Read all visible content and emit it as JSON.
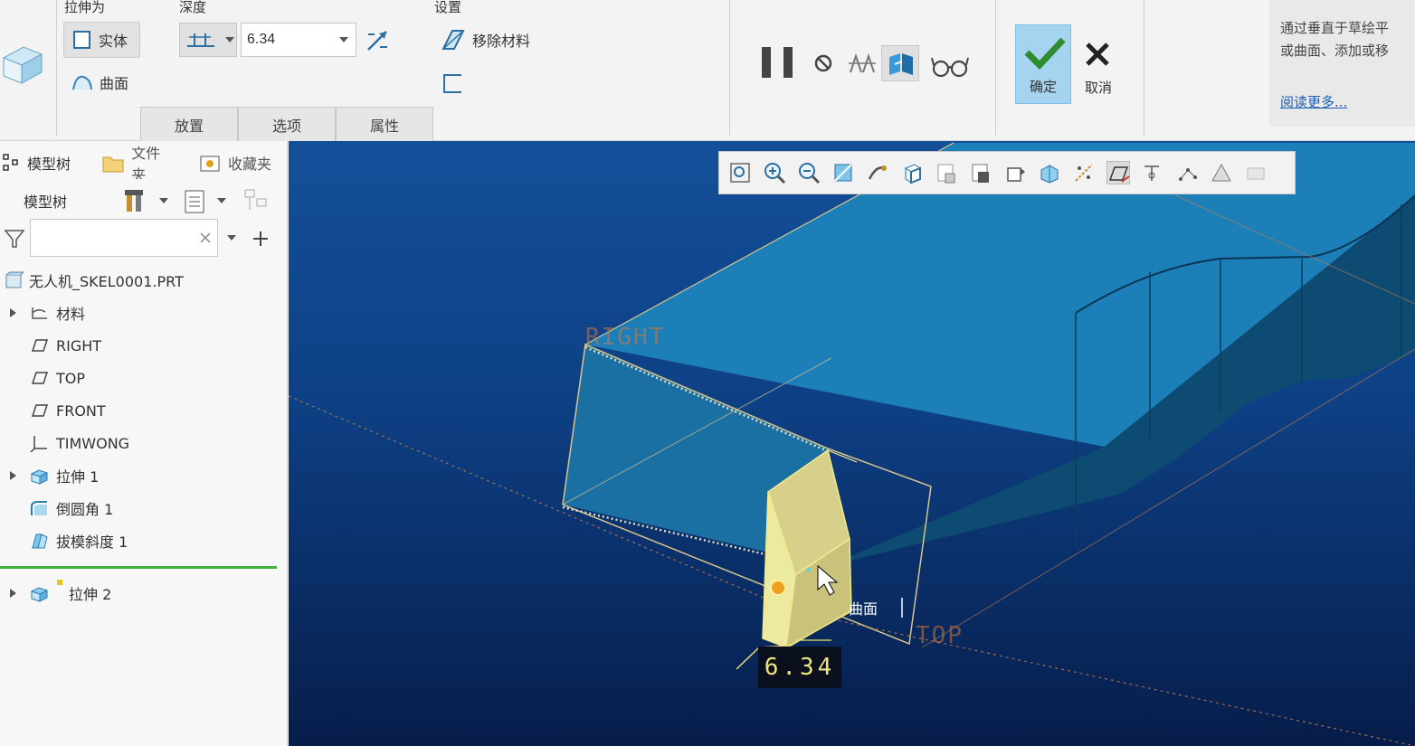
{
  "ribbon": {
    "groups": {
      "extrude_as": "拉伸为",
      "depth": "深度",
      "settings": "设置"
    },
    "solid_label": "实体",
    "surface_label": "曲面",
    "depth_value": "6.34",
    "remove_material_label": "移除材料",
    "tabs": [
      "放置",
      "选项",
      "属性"
    ],
    "ok_label": "确定",
    "cancel_label": "取消",
    "help_text_line1": "通过垂直于草绘平",
    "help_text_line2": "或曲面、添加或移",
    "help_link": "阅读更多..."
  },
  "left_panel": {
    "tabs": [
      "模型树",
      "文件夹",
      "收藏夹"
    ],
    "tree_title": "模型树",
    "search_placeholder": "",
    "tree_items": [
      {
        "label": "无人机_SKEL0001.PRT",
        "expandable": false,
        "icon": "part-icon"
      },
      {
        "label": "材料",
        "expandable": true,
        "icon": "material-icon"
      },
      {
        "label": "RIGHT",
        "expandable": false,
        "icon": "datum-plane-icon"
      },
      {
        "label": "TOP",
        "expandable": false,
        "icon": "datum-plane-icon"
      },
      {
        "label": "FRONT",
        "expandable": false,
        "icon": "datum-plane-icon"
      },
      {
        "label": "TIMWONG",
        "expandable": false,
        "icon": "csys-icon"
      },
      {
        "label": "拉伸 1",
        "expandable": true,
        "icon": "extrude-icon"
      },
      {
        "label": "倒圆角 1",
        "expandable": false,
        "icon": "round-icon"
      },
      {
        "label": "拔模斜度 1",
        "expandable": false,
        "icon": "draft-icon"
      },
      {
        "label": "拉伸 2",
        "expandable": true,
        "icon": "extrude-icon"
      }
    ]
  },
  "viewport": {
    "plane_labels": {
      "right": "RIGHT",
      "top": "TOP"
    },
    "depth_dimension": "6.34",
    "surface_label": "曲面"
  },
  "colors": {
    "accent_ok": "#a5d4f0",
    "viewport_top": "#14509a",
    "viewport_bottom": "#071d4a",
    "preview_yellow": "#ece9a0",
    "body_blue": "#1f6fa3"
  }
}
